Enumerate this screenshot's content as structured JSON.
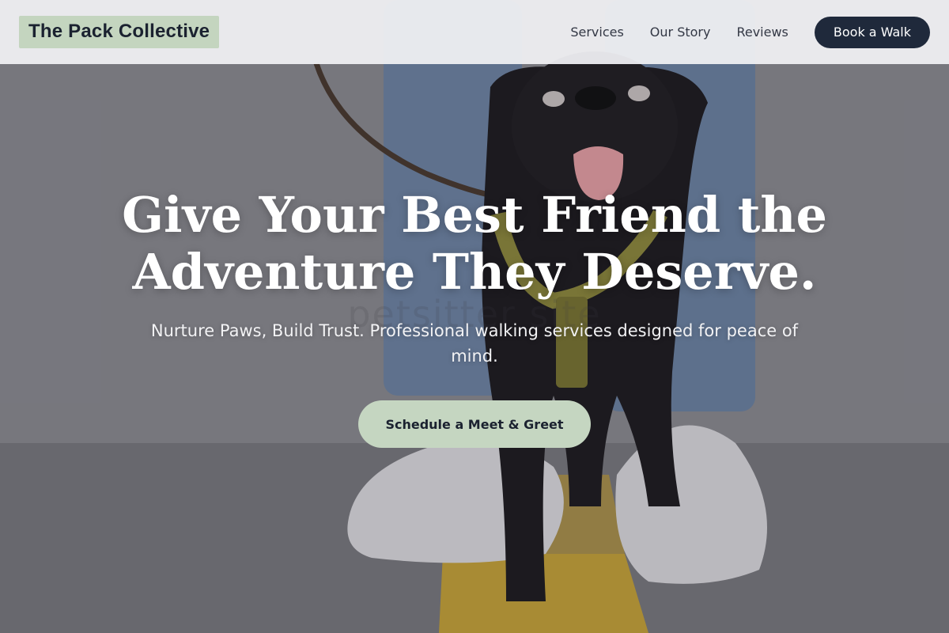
{
  "header": {
    "logo": "The Pack Collective",
    "nav": [
      {
        "label": "Services"
      },
      {
        "label": "Our Story"
      },
      {
        "label": "Reviews"
      }
    ],
    "cta_label": "Book a Walk"
  },
  "hero": {
    "title_line1": "Give Your Best Friend the",
    "title_line2": "Adventure They Deserve.",
    "subtitle": "Nurture Paws, Build Trust. Professional walking services designed for peace of mind.",
    "cta_label": "Schedule a Meet & Greet",
    "watermark": "petsitter site"
  },
  "colors": {
    "accent_green": "#c5d6c1",
    "navy": "#1f293b",
    "text_dark": "#1b2230"
  }
}
